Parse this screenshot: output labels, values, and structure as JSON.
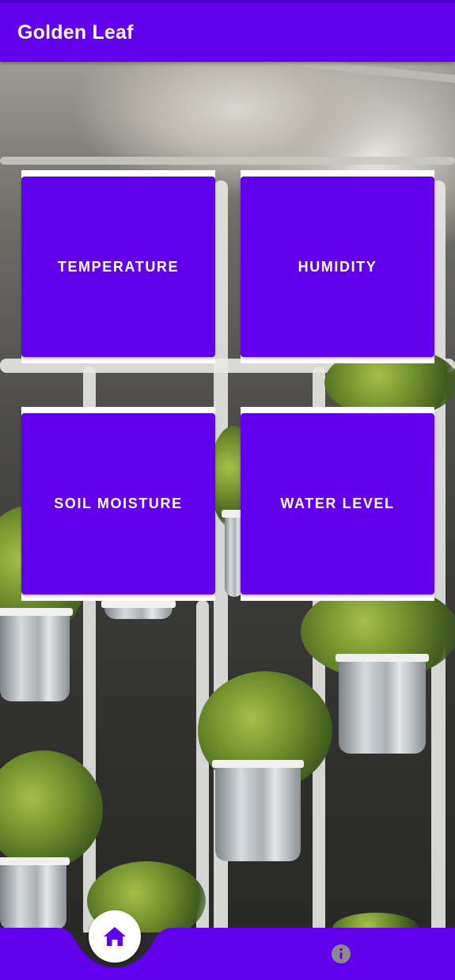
{
  "app": {
    "title": "Golden Leaf"
  },
  "cards": [
    {
      "label": "TEMPERATURE"
    },
    {
      "label": "HUMIDITY"
    },
    {
      "label": "SOIL MOISTURE"
    },
    {
      "label": "WATER LEVEL"
    }
  ],
  "bottom_nav": {
    "items": [
      {
        "icon": "home-icon",
        "active": true
      },
      {
        "icon": "info-icon",
        "active": false
      }
    ]
  },
  "colors": {
    "primary": "#6200ee",
    "card_text": "#ffffff",
    "inactive_icon": "#8a8a8a"
  }
}
